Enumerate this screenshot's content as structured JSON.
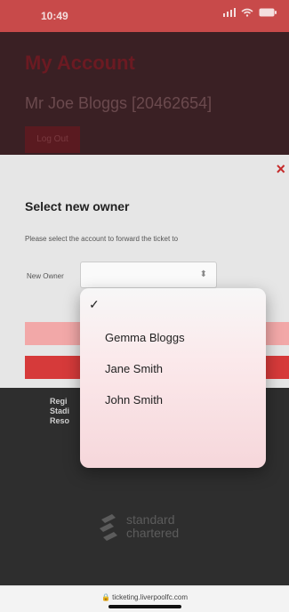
{
  "status_bar": {
    "time": "10:49"
  },
  "background": {
    "page_title": "My Account",
    "user": "Mr Joe Bloggs [20462654]",
    "button_label": "Log Out"
  },
  "modal": {
    "close_glyph": "×",
    "title": "Select new owner",
    "description": "Please select the account to forward the ticket to",
    "owner_label": "New Owner",
    "select_value": "",
    "small_lines": [
      "Regi",
      "Stadi",
      "Reso"
    ]
  },
  "dropdown": {
    "options": [
      "Gemma Bloggs",
      "Jane Smith",
      "John Smith"
    ],
    "checked_index": -1
  },
  "sponsor": {
    "line1": "standard",
    "line2": "chartered"
  },
  "browser": {
    "url": "ticketing.liverpoolfc.com"
  },
  "colors": {
    "accent": "#d63a3a",
    "pink": "#f2a8a8"
  }
}
